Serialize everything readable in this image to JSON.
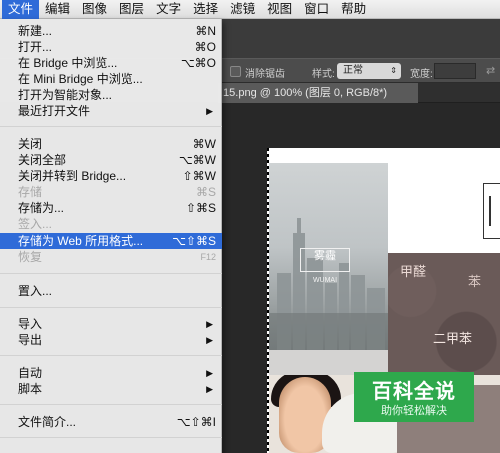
{
  "menubar": {
    "items": [
      "文件",
      "编辑",
      "图像",
      "图层",
      "文字",
      "选择",
      "滤镜",
      "视图",
      "窗口",
      "帮助"
    ],
    "active": "文件"
  },
  "options_bar": {
    "antialias_label": "消除锯齿",
    "style_label": "样式:",
    "style_value": "正常",
    "width_label": "宽度:"
  },
  "document_tab": {
    "title": ".15.png @ 100% (图层 0, RGB/8*)"
  },
  "file_menu": {
    "items": [
      {
        "label": "新建...",
        "shortcut": "⌘N"
      },
      {
        "label": "打开...",
        "shortcut": "⌘O"
      },
      {
        "label": "在 Bridge 中浏览...",
        "shortcut": "⌥⌘O"
      },
      {
        "label": "在 Mini Bridge 中浏览...",
        "shortcut": ""
      },
      {
        "label": "打开为智能对象...",
        "shortcut": ""
      },
      {
        "label": "最近打开文件",
        "shortcut": ""
      },
      {
        "label": "关闭",
        "shortcut": "⌘W"
      },
      {
        "label": "关闭全部",
        "shortcut": "⌥⌘W"
      },
      {
        "label": "关闭并转到 Bridge...",
        "shortcut": "⇧⌘W"
      },
      {
        "label": "存储",
        "shortcut": "⌘S"
      },
      {
        "label": "存储为...",
        "shortcut": "⇧⌘S"
      },
      {
        "label": "签入...",
        "shortcut": ""
      },
      {
        "label": "存储为 Web 所用格式...",
        "shortcut": "⌥⇧⌘S"
      },
      {
        "label": "恢复",
        "shortcut": "F12"
      },
      {
        "label": "置入...",
        "shortcut": ""
      },
      {
        "label": "导入",
        "shortcut": ""
      },
      {
        "label": "导出",
        "shortcut": ""
      },
      {
        "label": "自动",
        "shortcut": ""
      },
      {
        "label": "脚本",
        "shortcut": ""
      },
      {
        "label": "文件简介...",
        "shortcut": "⌥⇧⌘I"
      }
    ],
    "highlighted": "存储为 Web 所用格式..."
  },
  "canvas_image": {
    "watermark_cn": "雾霾",
    "watermark_en": "WUMAI",
    "calligraphy_1": "甲醛",
    "calligraphy_2": "二甲苯",
    "calligraphy_3": "苯"
  },
  "site_watermark": {
    "title": "百科全说",
    "subtitle": "助你轻松解决"
  },
  "colors": {
    "menu_highlight": "#2f6bd8",
    "watermark_green": "#2ea84c"
  }
}
